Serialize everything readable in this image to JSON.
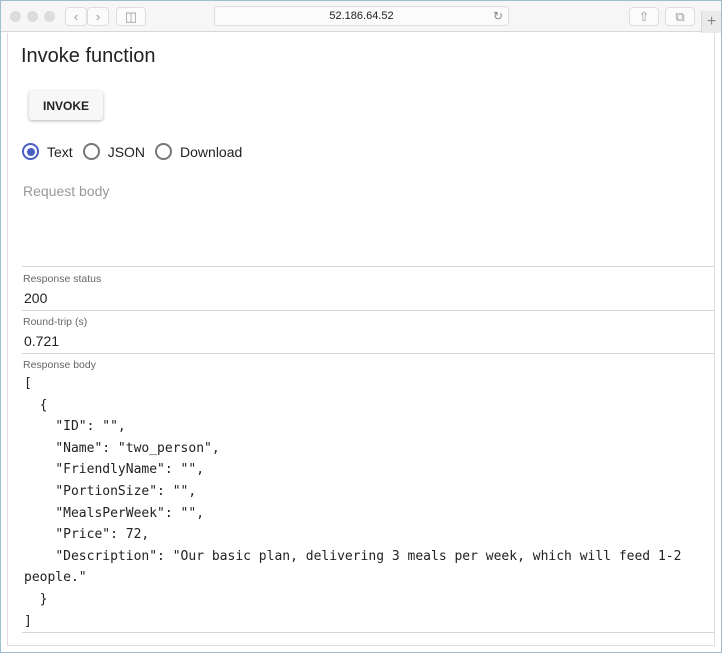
{
  "browser": {
    "url": "52.186.64.52",
    "icons": [
      "back-icon",
      "forward-icon",
      "sidebar-icon",
      "reload-icon",
      "share-icon",
      "tabs-icon",
      "new-tab-icon"
    ]
  },
  "page": {
    "title": "Invoke function",
    "invoke_label": "INVOKE",
    "radios": [
      {
        "label": "Text",
        "selected": true
      },
      {
        "label": "JSON",
        "selected": false
      },
      {
        "label": "Download",
        "selected": false
      }
    ],
    "request_placeholder": "Request body",
    "status_label": "Response status",
    "status_value": "200",
    "roundtrip_label": "Round-trip (s)",
    "roundtrip_value": "0.721",
    "body_label": "Response body",
    "body": "[\n  {\n    \"ID\": \"\",\n    \"Name\": \"two_person\",\n    \"FriendlyName\": \"\",\n    \"PortionSize\": \"\",\n    \"MealsPerWeek\": \"\",\n    \"Price\": 72,\n    \"Description\": \"Our basic plan, delivering 3 meals per week, which will feed 1-2 people.\"\n  }\n]",
    "accent": "#4a5fc1"
  }
}
